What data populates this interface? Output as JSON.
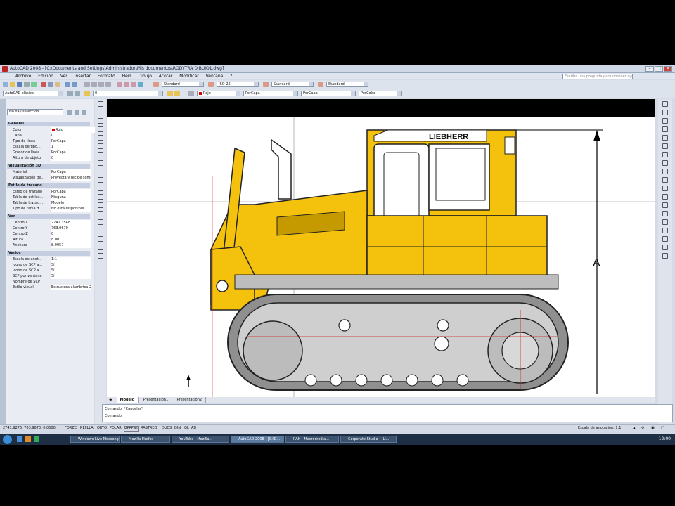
{
  "window": {
    "title": "AutoCAD 2008 - [C:\\Documents and Settings\\Administrador\\Mis documentos\\RODYTRA DIBUJO1.dwg]"
  },
  "menu": [
    "Archivo",
    "Edición",
    "Ver",
    "Insertar",
    "Formato",
    "Herr",
    "Dibujo",
    "Acotar",
    "Modificar",
    "Ventana",
    "?"
  ],
  "search": {
    "placeholder": "Escriba una pregunta para obtener ayuda"
  },
  "toolbar": {
    "workspace": "AutoCAD clásico",
    "text_style": "Standard",
    "dim_style": "ISO-25",
    "table_style": "Standard",
    "mleader_style": "Standard",
    "layer": "0",
    "color": "Rojo",
    "linetype": "PorCapa",
    "lineweight": "PorCapa",
    "plotstyle": "PorColor"
  },
  "props": {
    "selection": "No hay selección",
    "sections": [
      {
        "title": "General",
        "rows": [
          [
            "Color",
            "Rojo"
          ],
          [
            "Capa",
            "0"
          ],
          [
            "Tipo de línea",
            "PorCapa"
          ],
          [
            "Escala de tipo...",
            "1"
          ],
          [
            "Grosor de línea",
            "PorCapa"
          ],
          [
            "Altura de objeto",
            "0"
          ]
        ]
      },
      {
        "title": "Visualización 3D",
        "rows": [
          [
            "Material",
            "PorCapa"
          ],
          [
            "Visualización de...",
            "Proyecta y recibe sombras"
          ]
        ]
      },
      {
        "title": "Estilo de trazado",
        "rows": [
          [
            "Estilo de trazado",
            "PorCapa"
          ],
          [
            "Tabla de estilos...",
            "Ninguna"
          ],
          [
            "Tabla de trazad...",
            "Modelo"
          ],
          [
            "Tipo de tabla d...",
            "No está disponible"
          ]
        ]
      },
      {
        "title": "Ver",
        "rows": [
          [
            "Centro X",
            "2741.3548"
          ],
          [
            "Centro Y",
            "763.9670"
          ],
          [
            "Centro Z",
            "0"
          ],
          [
            "Altura",
            "8.00"
          ],
          [
            "Anchura",
            "8.9957"
          ]
        ]
      },
      {
        "title": "Varios",
        "rows": [
          [
            "Escala de anot...",
            "1:1"
          ],
          [
            "Icono de SCP a...",
            "Sí"
          ],
          [
            "Icono de SCP a...",
            "Sí"
          ],
          [
            "SCP por ventana",
            "Sí"
          ],
          [
            "Nombre de SCP",
            ""
          ],
          [
            "Estilo visual",
            "Estructura alámbrica 2D"
          ]
        ]
      }
    ]
  },
  "drawing": {
    "brand": "LIEBHERR",
    "dimension_label": "A"
  },
  "tabs": [
    "Modelo",
    "Presentación1",
    "Presentación2"
  ],
  "command": {
    "line1": "Comando: *Cancelar*",
    "line2": "Comando:"
  },
  "status": {
    "coords": "2741.9276, 763.9670, 0.0000",
    "toggles": [
      "FORZC",
      "REJILLA",
      "ORTO",
      "POLAR",
      "REFENT",
      "RASTREO",
      "DUCS",
      "DIN",
      "GL",
      "AD"
    ],
    "annot_scale": "Escala de anotación: 1:1"
  },
  "taskbar": {
    "items": [
      "Windows Live Messenger",
      "Mozilla Firefox",
      "YouTube - Mozilla...",
      "AutoCAD 2008 - [C:\\D...",
      "RAH - Macromedia...",
      "Corporate Studio - (Li..."
    ],
    "clock": "12:00"
  }
}
